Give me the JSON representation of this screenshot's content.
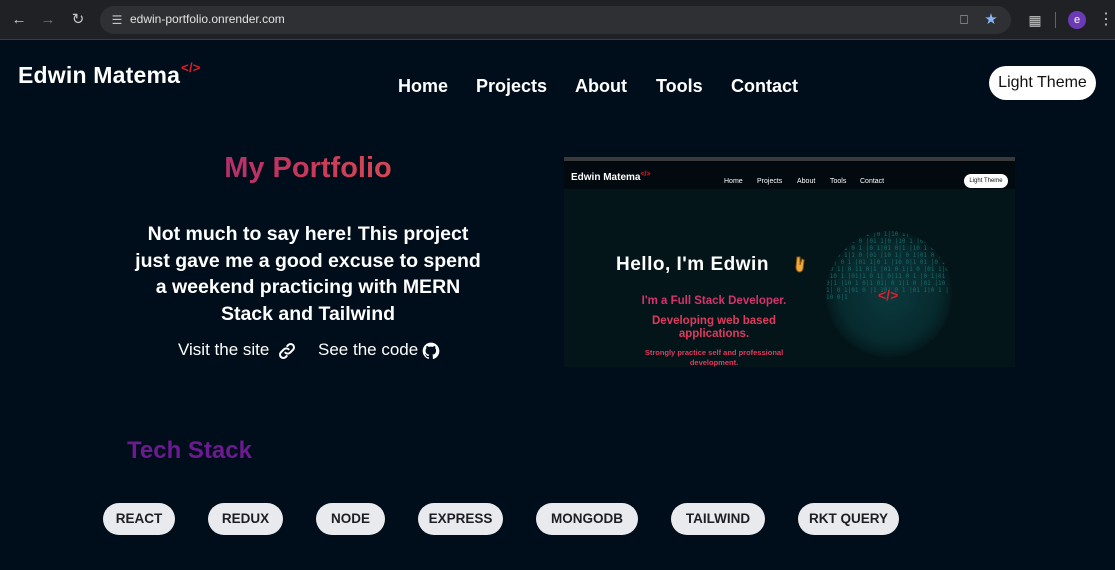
{
  "browser": {
    "url": "edwin-portfolio.onrender.com",
    "profile_initial": "e",
    "icons": {
      "back": "arrow-left-icon",
      "forward": "arrow-right-icon",
      "reload": "reload-icon",
      "site_info": "tune-icon",
      "cast": "screen-cast-icon",
      "bookmark": "star-icon",
      "extensions": "puzzle-icon",
      "menu": "kebab-menu-icon"
    },
    "accent": "#8ab4f8"
  },
  "header": {
    "logo": "Edwin Matema",
    "logo_mark": "</>",
    "nav": [
      "Home",
      "Projects",
      "About",
      "Tools",
      "Contact"
    ],
    "theme_button": "Light Theme"
  },
  "project": {
    "title": "My Portfolio",
    "description": "Not much to say here! This project just gave me a good excuse to spend a weekend practicing with MERN Stack and Tailwind",
    "visit_label": "Visit the site",
    "code_label": "See the code",
    "visit_icon": "link-icon",
    "code_icon": "github-icon"
  },
  "preview": {
    "logo": "Edwin Matema",
    "logo_mark": "</>",
    "nav": [
      "Home",
      "Projects",
      "About",
      "Tools",
      "Contact"
    ],
    "theme_button": "Light Theme",
    "hello": "Hello, I'm Edwin",
    "role": "I'm a Full Stack Developer.",
    "sub_line1": "Developing web based",
    "sub_line2": "applications.",
    "small_line1": "Strongly practice self and professional",
    "small_line2": "development.",
    "orb_tag": "</>"
  },
  "tech": {
    "title": "Tech Stack",
    "items": [
      "REACT",
      "REDUX",
      "NODE",
      "EXPRESS",
      "MONGODB",
      "TAILWIND",
      "RKT QUERY"
    ]
  },
  "colors": {
    "page_bg": "#000d1a",
    "brand_red": "#e11d2a",
    "tech_title": "#6b1b8f",
    "pill_bg": "#e8eaed"
  }
}
